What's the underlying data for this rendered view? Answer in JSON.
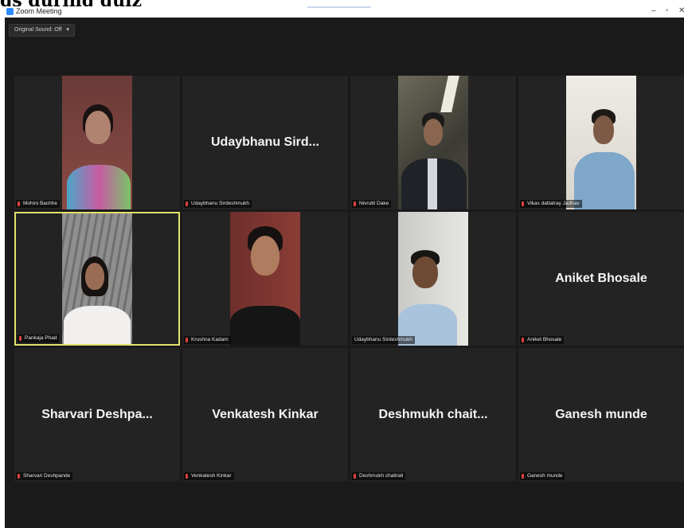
{
  "page_caption": "gs during quiz",
  "window": {
    "title": "Zoom Meeting",
    "controls": {
      "minimize": "–",
      "maximize": "▫",
      "close": "✕"
    }
  },
  "toolbar": {
    "original_sound_label": "Original Sound: Off",
    "dropdown_glyph": "▾"
  },
  "participants": [
    {
      "name_plate": "",
      "label": "Mohini Bachhe",
      "video": true,
      "active": false
    },
    {
      "name_plate": "Udaybhanu  Sird...",
      "label": "Udaybhanu Sirdeshmukh",
      "video": false,
      "active": false
    },
    {
      "name_plate": "",
      "label": "Nivrutti Dake",
      "video": true,
      "active": false
    },
    {
      "name_plate": "",
      "label": "Vikas dattatray Jadhav",
      "video": true,
      "active": false
    },
    {
      "name_plate": "",
      "label": "Pankaja Phad",
      "video": true,
      "active": true
    },
    {
      "name_plate": "",
      "label": "Krushna Kadam",
      "video": true,
      "active": false
    },
    {
      "name_plate": "",
      "label": "Udaybhanu Sirdeshmukh",
      "video": true,
      "active": false
    },
    {
      "name_plate": "Aniket Bhosale",
      "label": "Aniket Bhosale",
      "video": false,
      "active": false
    },
    {
      "name_plate": "Sharvari  Deshpa...",
      "label": "Sharvari Deshpande",
      "video": false,
      "active": false
    },
    {
      "name_plate": "Venkatesh Kinkar",
      "label": "Venkatesh Kinkar",
      "video": false,
      "active": false
    },
    {
      "name_plate": "Deshmukh  chait...",
      "label": "Deshmukh chaitrali",
      "video": false,
      "active": false
    },
    {
      "name_plate": "Ganesh munde",
      "label": "Ganesh munde",
      "video": false,
      "active": false
    }
  ],
  "colors": {
    "background": "#1a1a1a",
    "tile": "#232323",
    "active_border": "#e2e26b",
    "mic_muted": "#e0403a",
    "brand": "#2d8cff"
  }
}
